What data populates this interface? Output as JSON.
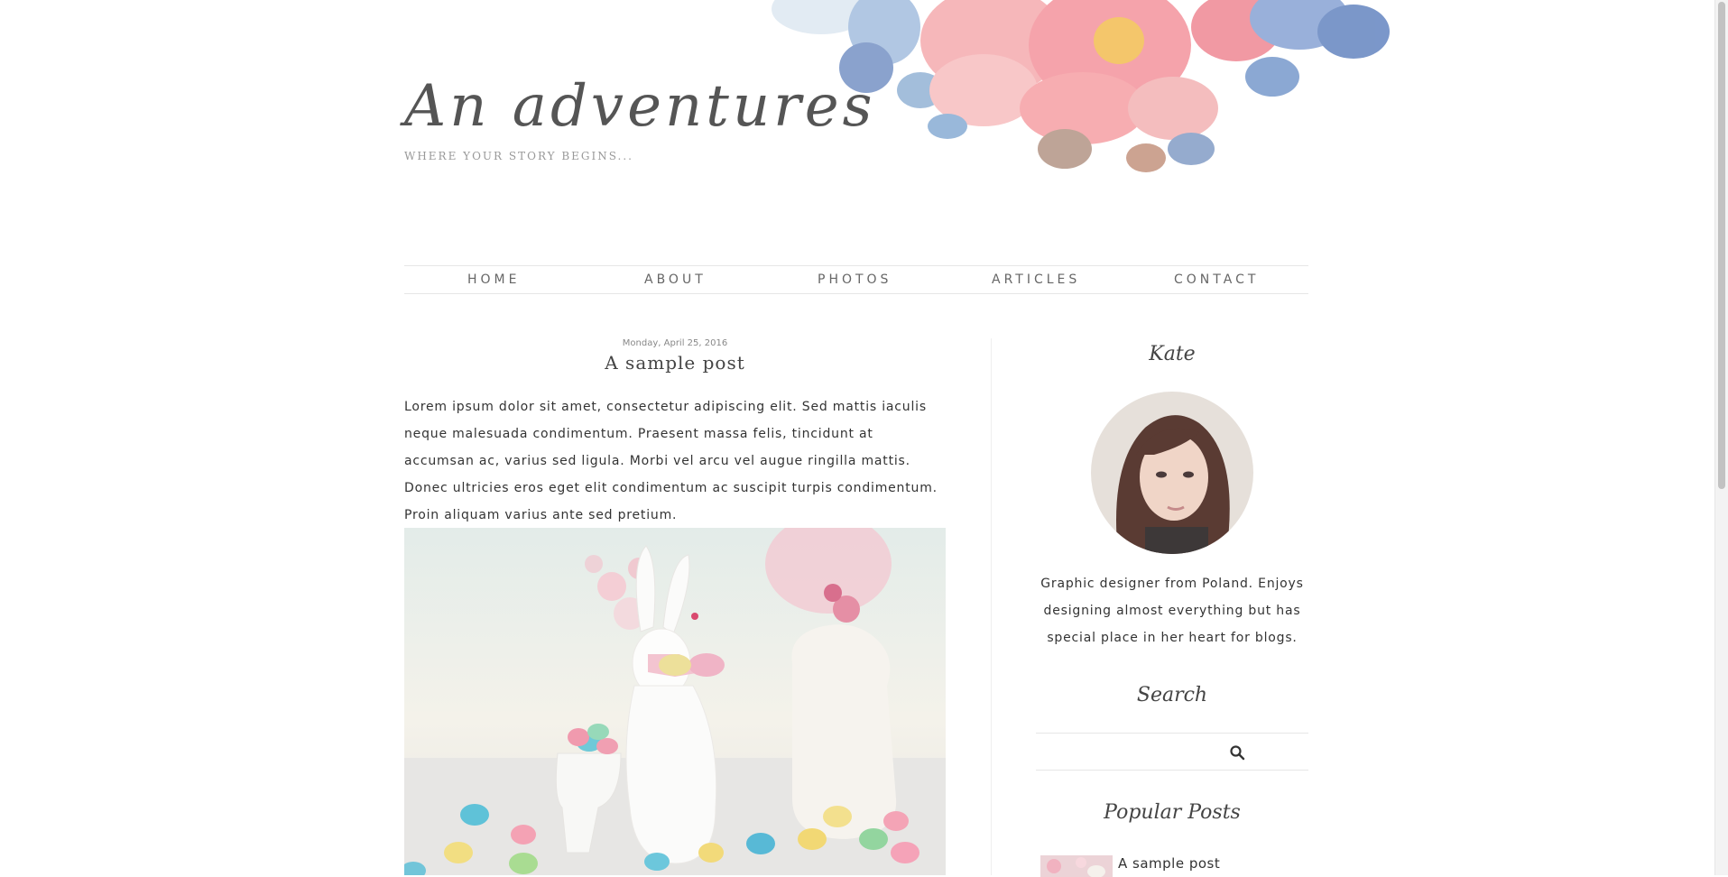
{
  "header": {
    "title": "An adventures",
    "tagline": "WHERE YOUR STORY BEGINS..."
  },
  "nav": {
    "items": [
      {
        "label": "HOME"
      },
      {
        "label": "ABOUT"
      },
      {
        "label": "PHOTOS"
      },
      {
        "label": "ARTICLES"
      },
      {
        "label": "CONTACT"
      }
    ]
  },
  "post": {
    "date": "Monday, April 25, 2016",
    "title": "A sample post",
    "body": "Lorem ipsum dolor sit amet, consectetur adipiscing elit. Sed mattis iaculis neque malesuada condimentum. Praesent massa felis, tincidunt at accumsan ac, varius sed ligula. Morbi vel arcu vel augue ringilla mattis. Donec ultricies eros eget elit condimentum ac suscipit turpis condimentum. Proin aliquam varius ante sed pretium."
  },
  "sidebar": {
    "profile": {
      "name": "Kate",
      "bio": "Graphic designer from Poland. Enjoys designing almost everything but has special place in her heart for blogs."
    },
    "search": {
      "title": "Search",
      "value": "",
      "icon": "search-icon"
    },
    "popular": {
      "title": "Popular Posts",
      "items": [
        {
          "title": "A sample post"
        }
      ]
    }
  },
  "colors": {
    "text": "#333333",
    "muted": "#999999",
    "line": "#e6e6e6",
    "floral_pink": "#f4a0a6",
    "floral_blue": "#8fb1d6"
  }
}
